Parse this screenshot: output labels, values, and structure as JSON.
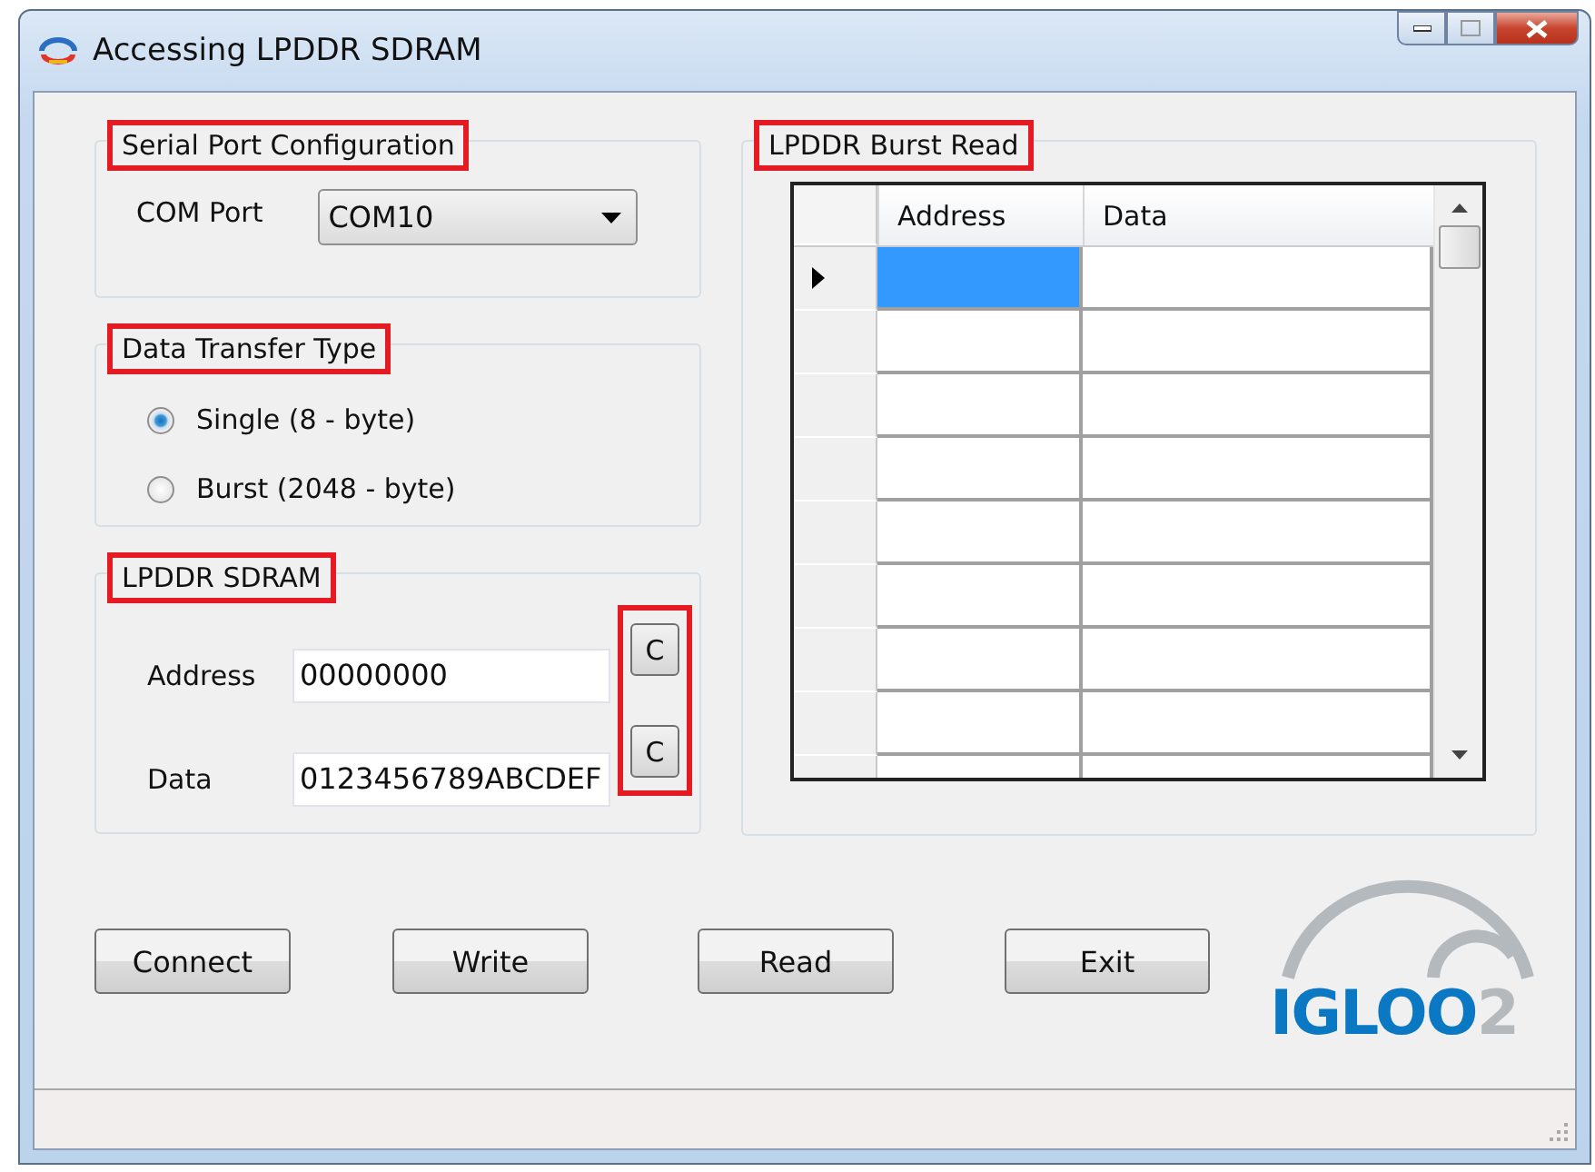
{
  "window": {
    "title": "Accessing LPDDR SDRAM"
  },
  "serial_port": {
    "title": "Serial Port Configuration",
    "highlighted": true,
    "com_port_label": "COM Port",
    "com_port_value": "COM10"
  },
  "transfer_type": {
    "title": "Data Transfer Type",
    "highlighted": true,
    "options": [
      {
        "label": "Single (8 - byte)",
        "selected": true
      },
      {
        "label": "Burst (2048 - byte)",
        "selected": false
      }
    ]
  },
  "sdram": {
    "title": "LPDDR SDRAM",
    "highlighted": true,
    "clear_buttons_highlighted": true,
    "fields": [
      {
        "label": "Address",
        "value": "00000000",
        "clear_label": "C"
      },
      {
        "label": "Data",
        "value": "0123456789ABCDEF",
        "clear_label": "C"
      }
    ]
  },
  "burst_read": {
    "title": "LPDDR Burst Read",
    "highlighted": true,
    "columns": [
      "Address",
      "Data"
    ],
    "rows": [
      {
        "current": true
      },
      {
        "current": false
      },
      {
        "current": false
      },
      {
        "current": false
      },
      {
        "current": false
      },
      {
        "current": false
      },
      {
        "current": false
      },
      {
        "current": false
      },
      {
        "current": false
      }
    ]
  },
  "buttons": [
    "Connect",
    "Write",
    "Read",
    "Exit"
  ],
  "logo": {
    "text": "IGLOO",
    "suffix": "2"
  }
}
